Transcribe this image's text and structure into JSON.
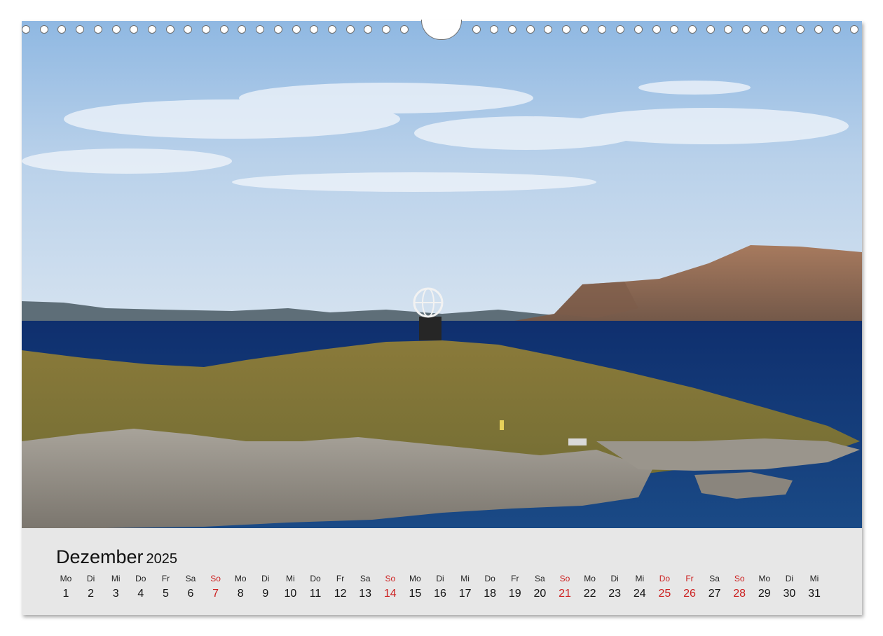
{
  "calendar": {
    "month": "Dezember",
    "year": "2025",
    "accent_color": "#cc1f1f",
    "days": [
      {
        "name": "Mo",
        "date": "1",
        "highlight": false
      },
      {
        "name": "Di",
        "date": "2",
        "highlight": false
      },
      {
        "name": "Mi",
        "date": "3",
        "highlight": false
      },
      {
        "name": "Do",
        "date": "4",
        "highlight": false
      },
      {
        "name": "Fr",
        "date": "5",
        "highlight": false
      },
      {
        "name": "Sa",
        "date": "6",
        "highlight": false
      },
      {
        "name": "So",
        "date": "7",
        "highlight": true
      },
      {
        "name": "Mo",
        "date": "8",
        "highlight": false
      },
      {
        "name": "Di",
        "date": "9",
        "highlight": false
      },
      {
        "name": "Mi",
        "date": "10",
        "highlight": false
      },
      {
        "name": "Do",
        "date": "11",
        "highlight": false
      },
      {
        "name": "Fr",
        "date": "12",
        "highlight": false
      },
      {
        "name": "Sa",
        "date": "13",
        "highlight": false
      },
      {
        "name": "So",
        "date": "14",
        "highlight": true
      },
      {
        "name": "Mo",
        "date": "15",
        "highlight": false
      },
      {
        "name": "Di",
        "date": "16",
        "highlight": false
      },
      {
        "name": "Mi",
        "date": "17",
        "highlight": false
      },
      {
        "name": "Do",
        "date": "18",
        "highlight": false
      },
      {
        "name": "Fr",
        "date": "19",
        "highlight": false
      },
      {
        "name": "Sa",
        "date": "20",
        "highlight": false
      },
      {
        "name": "So",
        "date": "21",
        "highlight": true
      },
      {
        "name": "Mo",
        "date": "22",
        "highlight": false
      },
      {
        "name": "Di",
        "date": "23",
        "highlight": false
      },
      {
        "name": "Mi",
        "date": "24",
        "highlight": false
      },
      {
        "name": "Do",
        "date": "25",
        "highlight": true
      },
      {
        "name": "Fr",
        "date": "26",
        "highlight": true
      },
      {
        "name": "Sa",
        "date": "27",
        "highlight": false
      },
      {
        "name": "So",
        "date": "28",
        "highlight": true
      },
      {
        "name": "Mo",
        "date": "29",
        "highlight": false
      },
      {
        "name": "Di",
        "date": "30",
        "highlight": false
      },
      {
        "name": "Mi",
        "date": "31",
        "highlight": false
      }
    ]
  }
}
